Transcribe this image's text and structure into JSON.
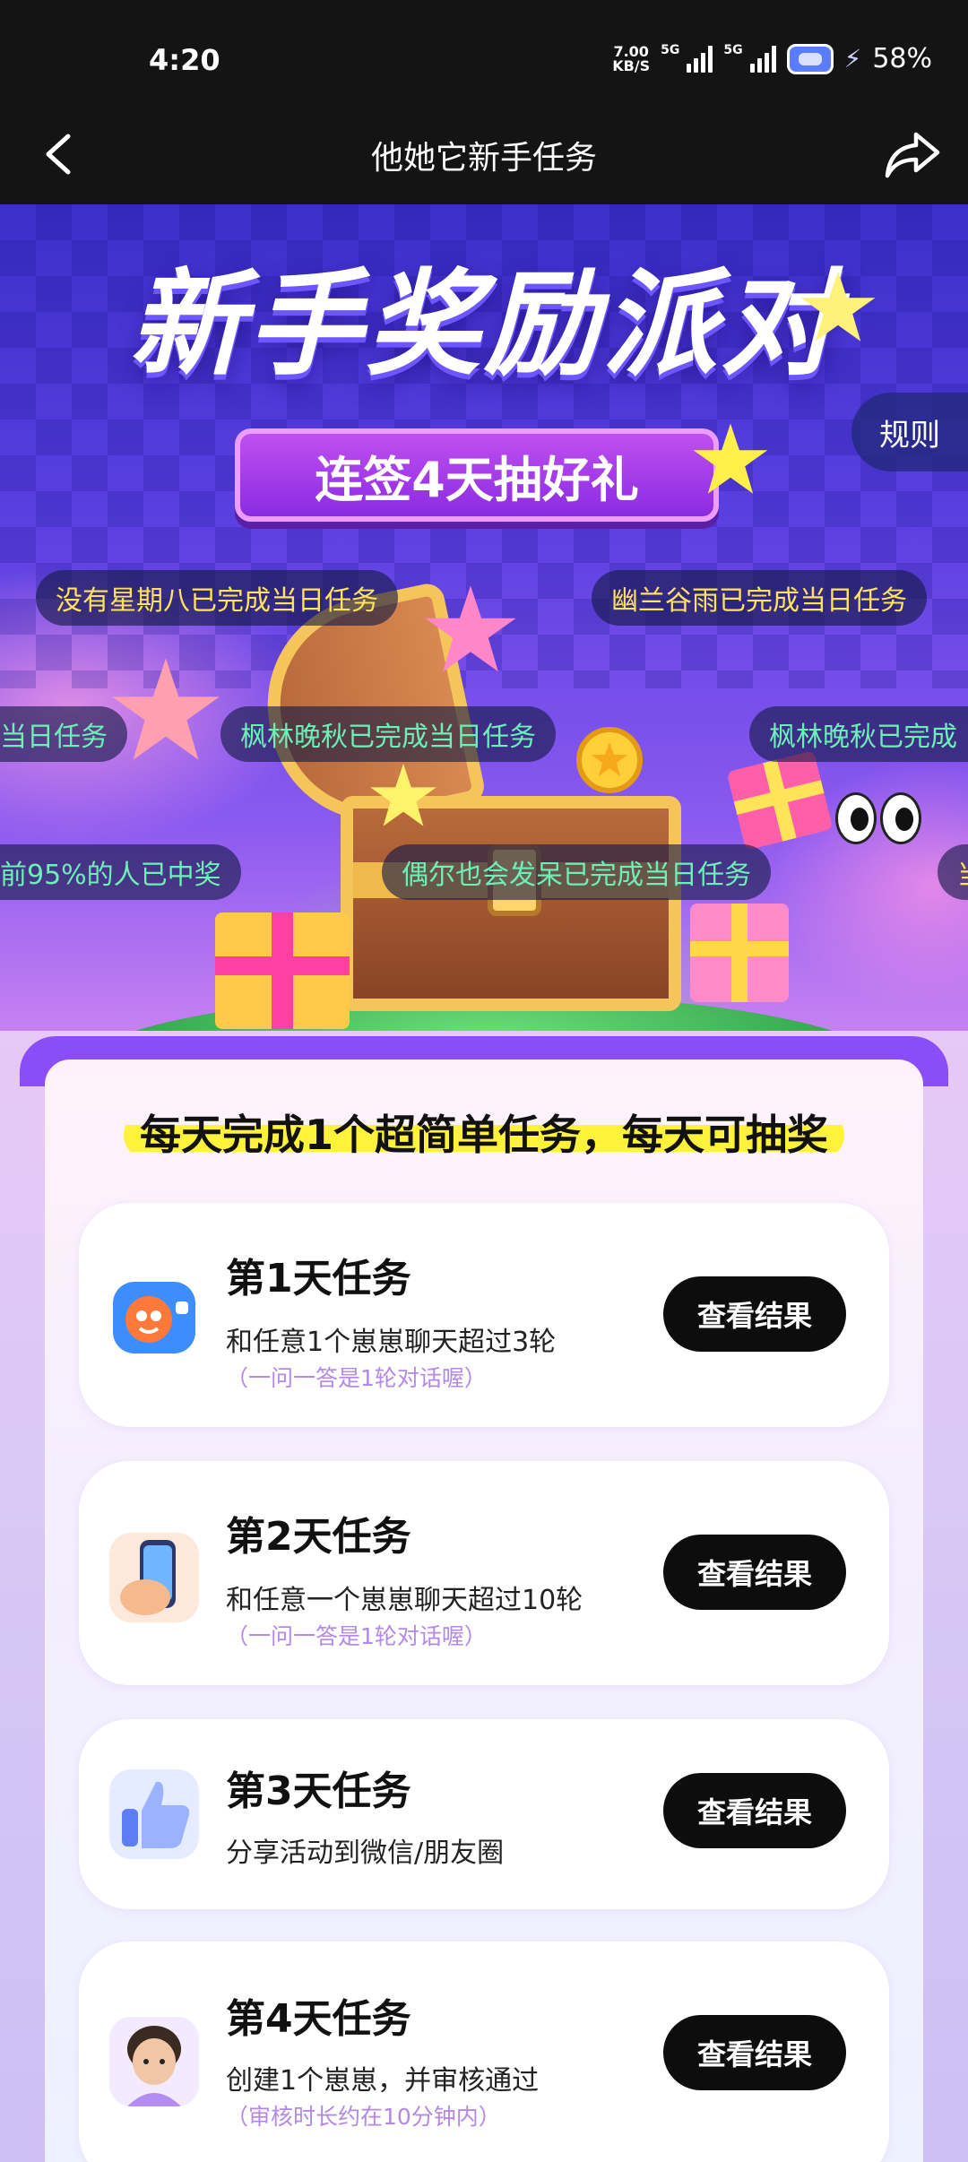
{
  "status_bar": {
    "time": "4:20",
    "net_speed_value": "7.00",
    "net_speed_unit": "KB/S",
    "sim1": "5G",
    "sim2": "5G",
    "battery": "58%"
  },
  "nav": {
    "title": "他她它新手任务",
    "back_icon": "chevron-left-icon",
    "share_icon": "share-arrow-icon"
  },
  "hero": {
    "title": "新手奖励派对",
    "ribbon": "连签4天抽好礼",
    "rules_label": "规则",
    "marquee": [
      {
        "text": "没有星期八已完成当日任务",
        "color": "yellow"
      },
      {
        "text": "幽兰谷雨已完成当日任务",
        "color": "yellow"
      },
      {
        "text": "当日任务",
        "color": "green"
      },
      {
        "text": "枫林晚秋已完成当日任务",
        "color": "green"
      },
      {
        "text": "枫林晚秋已完成",
        "color": "green"
      },
      {
        "text": "前95%的人已中奖",
        "color": "green"
      },
      {
        "text": "偶尔也会发呆已完成当日任务",
        "color": "green"
      },
      {
        "text": "当",
        "color": "yellow"
      }
    ]
  },
  "tasks_panel": {
    "headline": "每天完成1个超简单任务，每天可抽奖",
    "tasks": [
      {
        "title": "第1天任务",
        "desc": "和任意1个崽崽聊天超过3轮",
        "note": "（一问一答是1轮对话喔）",
        "button": "查看结果",
        "icon": "chat-bubble-mascot-icon"
      },
      {
        "title": "第2天任务",
        "desc": "和任意一个崽崽聊天超过10轮",
        "note": "（一问一答是1轮对话喔）",
        "button": "查看结果",
        "icon": "phone-in-hand-icon"
      },
      {
        "title": "第3天任务",
        "desc": "分享活动到微信/朋友圈",
        "note": "",
        "button": "查看结果",
        "icon": "thumbs-up-icon"
      },
      {
        "title": "第4天任务",
        "desc": "创建1个崽崽，并审核通过",
        "note": "（审核时长约在10分钟内）",
        "button": "查看结果",
        "icon": "avatar-boy-icon"
      }
    ]
  },
  "colors": {
    "accent_purple": "#8b4df7",
    "highlight_yellow": "#fff23b",
    "button_black": "#0d0d0d",
    "note_purple": "#b489e6"
  }
}
